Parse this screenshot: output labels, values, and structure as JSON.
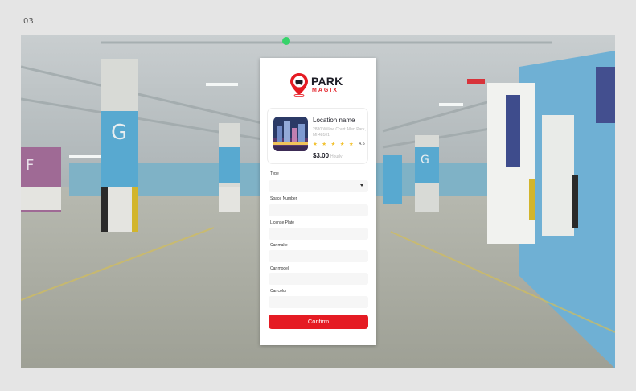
{
  "frame_label": "03",
  "brand": {
    "name": "PARK",
    "sub": "MAGIX",
    "accent": "#e51b23"
  },
  "location": {
    "name": "Location name",
    "address": "2880 Willow Court Allen Park, MI 48101",
    "stars": "★ ★ ★ ★ ★",
    "rating": "4.5",
    "price": "$3.00",
    "price_unit": "Hourly"
  },
  "form": {
    "type_label": "Type",
    "space_label": "Space Number",
    "plate_label": "License Plate",
    "make_label": "Car make",
    "model_label": "Car model",
    "color_label": "Car color"
  },
  "confirm_label": "Confirm",
  "icons": {
    "logo": "map-pin-car-icon",
    "select": "chevron-down-icon"
  }
}
